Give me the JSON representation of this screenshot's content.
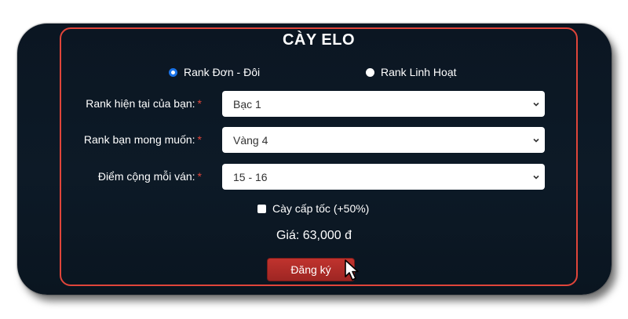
{
  "form": {
    "title": "CÀY ELO",
    "mode_options": [
      {
        "label": "Rank Đơn - Đôi",
        "selected": true
      },
      {
        "label": "Rank Linh Hoạt",
        "selected": false
      }
    ],
    "fields": [
      {
        "label": "Rank hiện tại của bạn:",
        "required_mark": "*",
        "value": "Bạc 1"
      },
      {
        "label": "Rank bạn mong muốn:",
        "required_mark": "*",
        "value": "Vàng 4"
      },
      {
        "label": "Điểm cộng mỗi ván:",
        "required_mark": "*",
        "value": "15 - 16"
      }
    ],
    "express_checkbox": {
      "label": "Cày cấp tốc (+50%)",
      "checked": false
    },
    "price_text": "Giá: 63,000 đ",
    "submit_label": "Đăng ký"
  },
  "colors": {
    "panel_border": "#e0453a",
    "background": "#0b1622",
    "button": "#b02d29",
    "radio_selected": "#1a73e8",
    "required": "#e0453a"
  },
  "icons": {
    "select_arrow": "chevron-down-icon",
    "pointer": "hand-cursor-icon"
  }
}
